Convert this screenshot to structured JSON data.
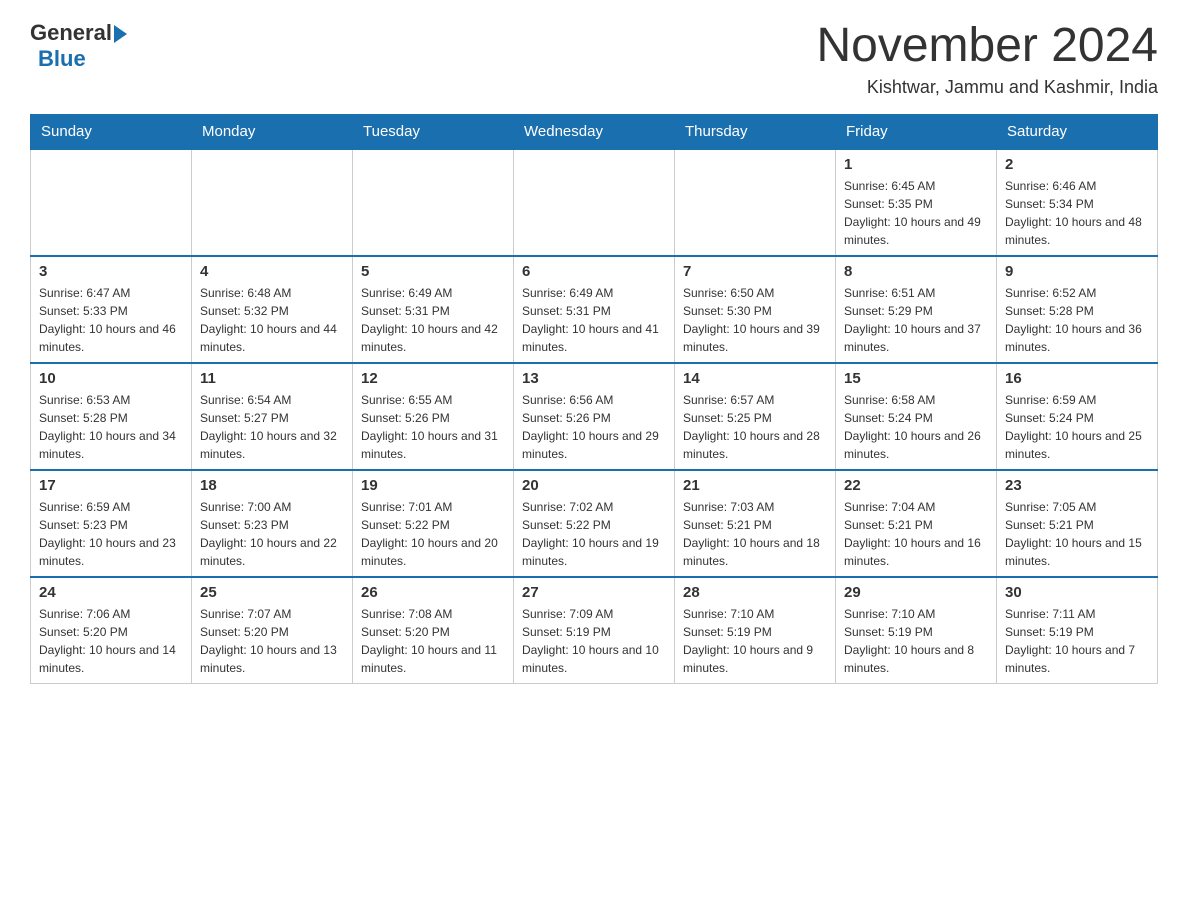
{
  "header": {
    "logo_general": "General",
    "logo_blue": "Blue",
    "month_title": "November 2024",
    "location": "Kishtwar, Jammu and Kashmir, India"
  },
  "days_of_week": [
    "Sunday",
    "Monday",
    "Tuesday",
    "Wednesday",
    "Thursday",
    "Friday",
    "Saturday"
  ],
  "weeks": [
    [
      {
        "day": "",
        "info": ""
      },
      {
        "day": "",
        "info": ""
      },
      {
        "day": "",
        "info": ""
      },
      {
        "day": "",
        "info": ""
      },
      {
        "day": "",
        "info": ""
      },
      {
        "day": "1",
        "info": "Sunrise: 6:45 AM\nSunset: 5:35 PM\nDaylight: 10 hours and 49 minutes."
      },
      {
        "day": "2",
        "info": "Sunrise: 6:46 AM\nSunset: 5:34 PM\nDaylight: 10 hours and 48 minutes."
      }
    ],
    [
      {
        "day": "3",
        "info": "Sunrise: 6:47 AM\nSunset: 5:33 PM\nDaylight: 10 hours and 46 minutes."
      },
      {
        "day": "4",
        "info": "Sunrise: 6:48 AM\nSunset: 5:32 PM\nDaylight: 10 hours and 44 minutes."
      },
      {
        "day": "5",
        "info": "Sunrise: 6:49 AM\nSunset: 5:31 PM\nDaylight: 10 hours and 42 minutes."
      },
      {
        "day": "6",
        "info": "Sunrise: 6:49 AM\nSunset: 5:31 PM\nDaylight: 10 hours and 41 minutes."
      },
      {
        "day": "7",
        "info": "Sunrise: 6:50 AM\nSunset: 5:30 PM\nDaylight: 10 hours and 39 minutes."
      },
      {
        "day": "8",
        "info": "Sunrise: 6:51 AM\nSunset: 5:29 PM\nDaylight: 10 hours and 37 minutes."
      },
      {
        "day": "9",
        "info": "Sunrise: 6:52 AM\nSunset: 5:28 PM\nDaylight: 10 hours and 36 minutes."
      }
    ],
    [
      {
        "day": "10",
        "info": "Sunrise: 6:53 AM\nSunset: 5:28 PM\nDaylight: 10 hours and 34 minutes."
      },
      {
        "day": "11",
        "info": "Sunrise: 6:54 AM\nSunset: 5:27 PM\nDaylight: 10 hours and 32 minutes."
      },
      {
        "day": "12",
        "info": "Sunrise: 6:55 AM\nSunset: 5:26 PM\nDaylight: 10 hours and 31 minutes."
      },
      {
        "day": "13",
        "info": "Sunrise: 6:56 AM\nSunset: 5:26 PM\nDaylight: 10 hours and 29 minutes."
      },
      {
        "day": "14",
        "info": "Sunrise: 6:57 AM\nSunset: 5:25 PM\nDaylight: 10 hours and 28 minutes."
      },
      {
        "day": "15",
        "info": "Sunrise: 6:58 AM\nSunset: 5:24 PM\nDaylight: 10 hours and 26 minutes."
      },
      {
        "day": "16",
        "info": "Sunrise: 6:59 AM\nSunset: 5:24 PM\nDaylight: 10 hours and 25 minutes."
      }
    ],
    [
      {
        "day": "17",
        "info": "Sunrise: 6:59 AM\nSunset: 5:23 PM\nDaylight: 10 hours and 23 minutes."
      },
      {
        "day": "18",
        "info": "Sunrise: 7:00 AM\nSunset: 5:23 PM\nDaylight: 10 hours and 22 minutes."
      },
      {
        "day": "19",
        "info": "Sunrise: 7:01 AM\nSunset: 5:22 PM\nDaylight: 10 hours and 20 minutes."
      },
      {
        "day": "20",
        "info": "Sunrise: 7:02 AM\nSunset: 5:22 PM\nDaylight: 10 hours and 19 minutes."
      },
      {
        "day": "21",
        "info": "Sunrise: 7:03 AM\nSunset: 5:21 PM\nDaylight: 10 hours and 18 minutes."
      },
      {
        "day": "22",
        "info": "Sunrise: 7:04 AM\nSunset: 5:21 PM\nDaylight: 10 hours and 16 minutes."
      },
      {
        "day": "23",
        "info": "Sunrise: 7:05 AM\nSunset: 5:21 PM\nDaylight: 10 hours and 15 minutes."
      }
    ],
    [
      {
        "day": "24",
        "info": "Sunrise: 7:06 AM\nSunset: 5:20 PM\nDaylight: 10 hours and 14 minutes."
      },
      {
        "day": "25",
        "info": "Sunrise: 7:07 AM\nSunset: 5:20 PM\nDaylight: 10 hours and 13 minutes."
      },
      {
        "day": "26",
        "info": "Sunrise: 7:08 AM\nSunset: 5:20 PM\nDaylight: 10 hours and 11 minutes."
      },
      {
        "day": "27",
        "info": "Sunrise: 7:09 AM\nSunset: 5:19 PM\nDaylight: 10 hours and 10 minutes."
      },
      {
        "day": "28",
        "info": "Sunrise: 7:10 AM\nSunset: 5:19 PM\nDaylight: 10 hours and 9 minutes."
      },
      {
        "day": "29",
        "info": "Sunrise: 7:10 AM\nSunset: 5:19 PM\nDaylight: 10 hours and 8 minutes."
      },
      {
        "day": "30",
        "info": "Sunrise: 7:11 AM\nSunset: 5:19 PM\nDaylight: 10 hours and 7 minutes."
      }
    ]
  ]
}
